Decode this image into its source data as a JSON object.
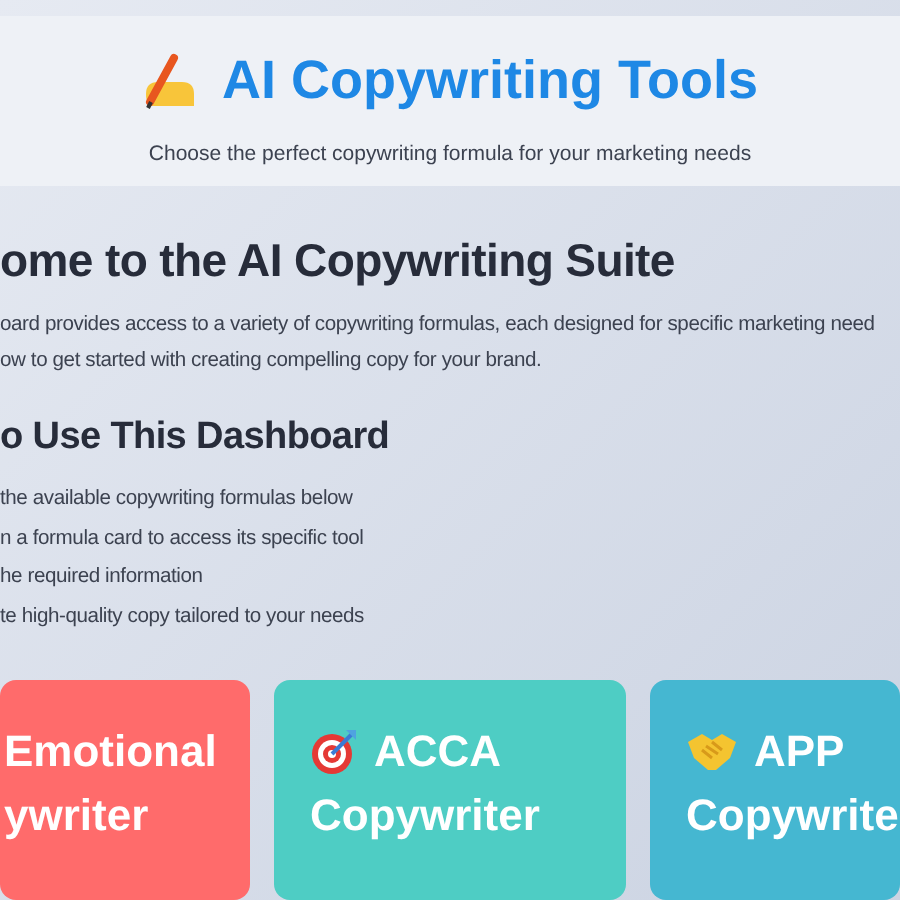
{
  "header": {
    "title": "AI Copywriting Tools",
    "subtitle": "Choose the perfect copywriting formula for your marketing needs"
  },
  "welcome": {
    "heading": "ome to the AI Copywriting Suite",
    "lines": [
      "oard provides access to a variety of copywriting formulas, each designed for specific marketing need",
      "ow to get started with creating compelling copy for your brand."
    ]
  },
  "guide": {
    "heading": "o Use This Dashboard",
    "steps": [
      "the available copywriting formulas below",
      "n a formula card to access its specific tool",
      "he required information",
      "te high-quality copy tailored to your needs"
    ]
  },
  "cards": [
    {
      "kind": "plain",
      "lines": [
        "Emotional",
        "ywriter"
      ],
      "color": "#ff6b6b"
    },
    {
      "kind": "target",
      "lines": [
        "ACCA",
        "Copywriter"
      ],
      "color": "#4ecdc4"
    },
    {
      "kind": "handshake",
      "lines": [
        "APP",
        "Copywrite"
      ],
      "color": "#45b7d1"
    }
  ]
}
